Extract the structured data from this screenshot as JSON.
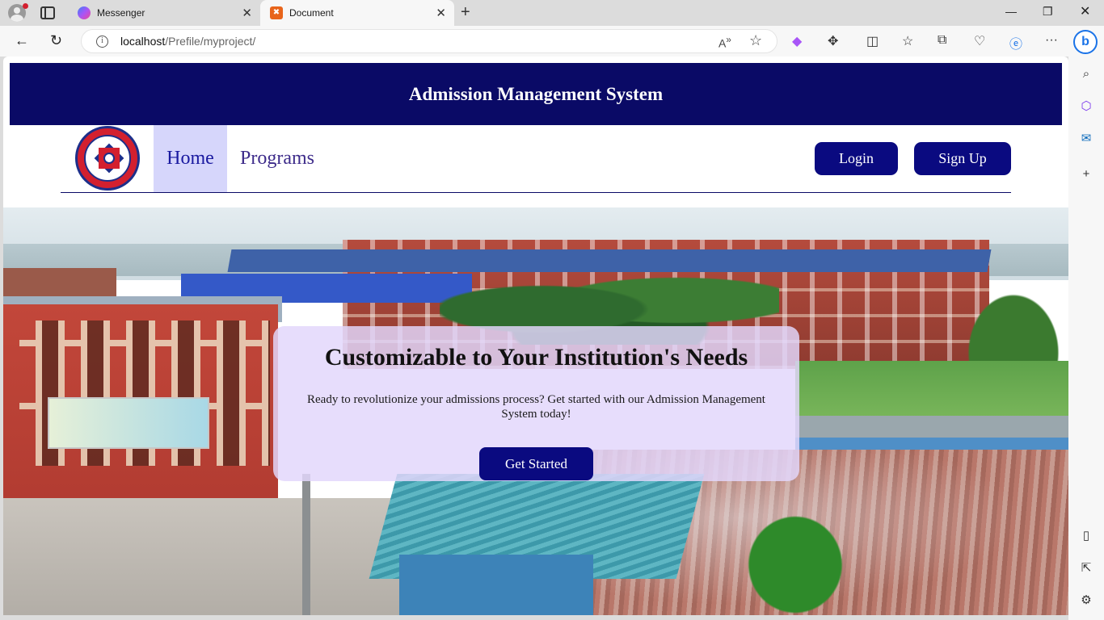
{
  "browser": {
    "tabs": [
      {
        "title": "Messenger",
        "active": false,
        "icon": "messenger-icon"
      },
      {
        "title": "Document",
        "active": true,
        "icon": "xampp-icon"
      }
    ],
    "url_host": "localhost",
    "url_path": "/Prefile/myproject/",
    "toolbar_icons": [
      "read-aloud-icon",
      "favorite-star-icon",
      "copilot-icon",
      "extensions-icon",
      "split-screen-icon",
      "favorites-icon",
      "collections-icon",
      "performance-icon",
      "edge-icon",
      "more-icon",
      "bing-icon"
    ],
    "sidebar_icons": [
      "search-icon",
      "office-icon",
      "outlook-icon",
      "add-icon",
      "sidebar-toggle-icon",
      "open-external-icon",
      "settings-icon"
    ],
    "accent": "#0a0a66"
  },
  "page": {
    "header_title": "Admission Management System",
    "nav": {
      "home": "Home",
      "programs": "Programs",
      "login": "Login",
      "signup": "Sign Up"
    },
    "hero": {
      "title": "Customizable to Your Institution's Needs",
      "text": "Ready to revolutionize your admissions process? Get started with our Admission Management System today!",
      "cta": "Get Started"
    },
    "colors": {
      "header_bg": "#0a0a66",
      "button_bg": "#0a0a80",
      "active_nav_bg": "#d6d6fb",
      "card_bg": "#e2d6fc"
    }
  }
}
